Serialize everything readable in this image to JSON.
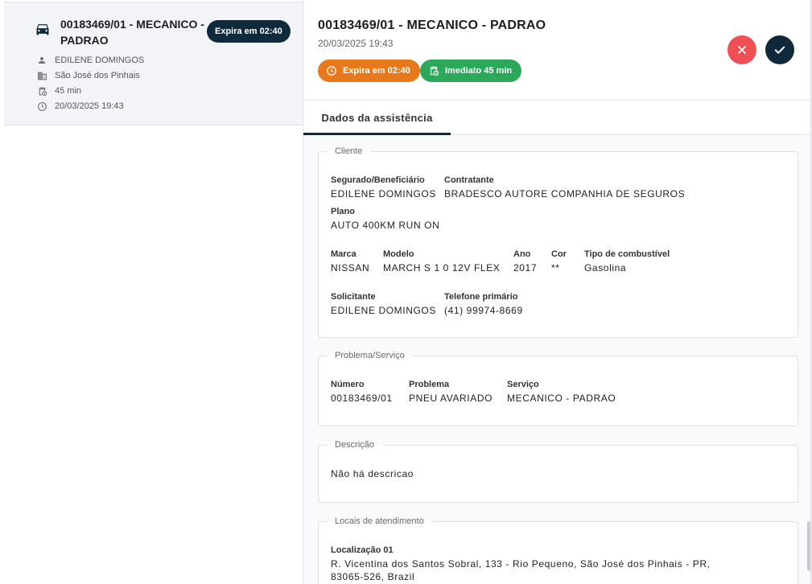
{
  "list_card": {
    "title": "00183469/01 - MECANICO - PADRAO",
    "expires_badge": "Expira em 02:40",
    "client_name": "EDILENE DOMINGOS",
    "city": "São José dos Pinhais",
    "duration": "45 min",
    "datetime": "20/03/2025 19:43"
  },
  "detail": {
    "title": "00183469/01 - MECANICO - PADRAO",
    "datetime": "20/03/2025 19:43",
    "expires_pill": "Expira em 02:40",
    "immediate_pill": "Imediato 45 min",
    "tab_label": "Dados da assistência"
  },
  "cliente": {
    "legend": "Cliente",
    "segurado_label": "Segurado/Beneficiário",
    "segurado_value": "EDILENE DOMINGOS",
    "contratante_label": "Contratante",
    "contratante_value": "BRADESCO AUTORE COMPANHIA DE SEGUROS",
    "plano_label": "Plano",
    "plano_value": "AUTO 400KM RUN ON",
    "marca_label": "Marca",
    "marca_value": "NISSAN",
    "modelo_label": "Modelo",
    "modelo_value": "MARCH S 1 0 12V FLEX",
    "ano_label": "Ano",
    "ano_value": "2017",
    "cor_label": "Cor",
    "cor_value": "**",
    "combustivel_label": "Tipo de combustível",
    "combustivel_value": "Gasolina",
    "solicitante_label": "Solicitante",
    "solicitante_value": "EDILENE DOMINGOS",
    "telefone_label": "Telefone primário",
    "telefone_value": "(41) 99974-8669"
  },
  "problema": {
    "legend": "Problema/Serviço",
    "numero_label": "Número",
    "numero_value": "00183469/01",
    "problema_label": "Problema",
    "problema_value": "PNEU AVARIADO",
    "servico_label": "Serviço",
    "servico_value": "MECANICO - PADRAO"
  },
  "descricao": {
    "legend": "Descrição",
    "value": "Não há descricao"
  },
  "locais": {
    "legend": "Locais de atendimento",
    "localizacao_label": "Localização 01",
    "localizacao_line1": "R. Vicentina dos Santos Sobral, 133 - Rio Pequeno, São José dos Pinhais - PR,",
    "localizacao_line2": "83065-526, Brazil"
  },
  "colors": {
    "dark_navy": "#10293a",
    "orange": "#e8791b",
    "green": "#2ca85a",
    "red": "#ef4f55"
  },
  "icons": [
    "car-icon",
    "person-icon",
    "building-icon",
    "clipboard-clock-icon",
    "clock-icon",
    "close-icon",
    "check-icon"
  ]
}
